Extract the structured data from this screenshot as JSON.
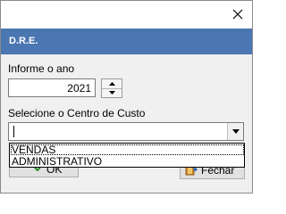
{
  "titlebar": {
    "close_icon": "close-icon"
  },
  "header": {
    "title": "D.R.E."
  },
  "year": {
    "label": "Informe o ano",
    "value": "2021"
  },
  "cost_center": {
    "label": "Selecione o Centro de Custo",
    "value": "",
    "options": [
      "VENDAS",
      "ADMINISTRATIVO"
    ]
  },
  "buttons": {
    "ok": "OK",
    "close": "Fechar"
  },
  "colors": {
    "header_band": "#4a76b1",
    "window_bg": "#f0f0f0"
  }
}
